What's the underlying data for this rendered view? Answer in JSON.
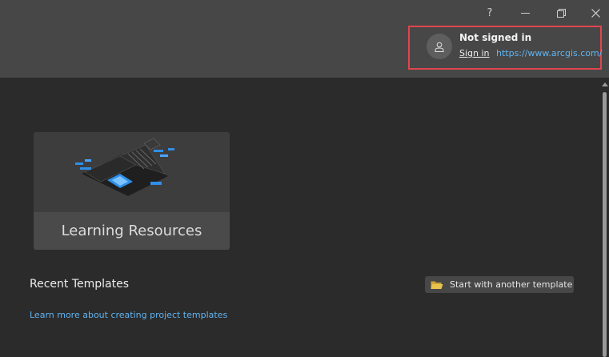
{
  "window": {
    "help_label": "?",
    "minimize_icon": "minimize-icon",
    "restore_icon": "restore-icon",
    "close_icon": "close-icon"
  },
  "account": {
    "status": "Not signed in",
    "sign_in_label": "Sign in",
    "portal_url": "https://www.arcgis.com/",
    "avatar_icon": "user-icon",
    "highlight_color": "#e0454e"
  },
  "learning_card": {
    "label": "Learning Resources",
    "art_icon": "open-book-illustration"
  },
  "recent_templates": {
    "title": "Recent Templates",
    "start_button_label": "Start with another template",
    "start_button_icon": "folder-icon",
    "learn_more_link": "Learn more about creating project templates"
  },
  "colors": {
    "background": "#2b2b2b",
    "header": "#474747",
    "link": "#5fb4f2",
    "accent_blue": "#2f8fe8"
  }
}
